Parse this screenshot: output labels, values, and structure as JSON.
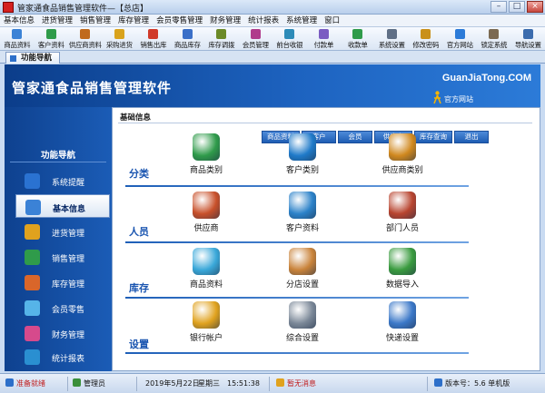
{
  "window": {
    "title": "管家通食品销售管理软件—【总店】",
    "app_icon": "app-logo-icon",
    "buttons": [
      "–",
      "□",
      "×"
    ]
  },
  "menu": [
    "基本信息",
    "进货管理",
    "销售管理",
    "库存管理",
    "会员零售管理",
    "财务管理",
    "统计报表",
    "系统管理",
    "窗口"
  ],
  "toolbar": [
    {
      "label": "商品资料",
      "icon": "goods-icon",
      "color": "#3b82d6"
    },
    {
      "label": "客户资料",
      "icon": "customer-icon",
      "color": "#2f9b4a"
    },
    {
      "label": "供应商资料",
      "icon": "supplier-icon",
      "color": "#c06a1d"
    },
    {
      "label": "采购进货",
      "icon": "purchase-icon",
      "color": "#d9a31c"
    },
    {
      "label": "销售出库",
      "icon": "sales-icon",
      "color": "#d03a2a"
    },
    {
      "label": "商品库存",
      "icon": "stock-icon",
      "color": "#3a6fc8"
    },
    {
      "label": "库存调拨",
      "icon": "transfer-icon",
      "color": "#6b8a28"
    },
    {
      "label": "会员管理",
      "icon": "member-icon",
      "color": "#b03c8c"
    },
    {
      "label": "前台收银",
      "icon": "cashier-icon",
      "color": "#2d8bb8"
    },
    {
      "label": "付款单",
      "icon": "payment-icon",
      "color": "#7a5cc2"
    },
    {
      "label": "收款单",
      "icon": "receipt-icon",
      "color": "#2f9b4a"
    },
    {
      "label": "系统设置",
      "icon": "settings-icon",
      "color": "#5f6f86"
    },
    {
      "label": "修改密码",
      "icon": "password-icon",
      "color": "#c9901a"
    },
    {
      "label": "官方网站",
      "icon": "website-icon",
      "color": "#2c7bd8"
    },
    {
      "label": "锁定系统",
      "icon": "lock-icon",
      "color": "#7b6a52"
    },
    {
      "label": "导航设置",
      "icon": "nav-settings-icon",
      "color": "#3b6cae"
    }
  ],
  "tab": {
    "label": "功能导航",
    "icon": "navigation-icon"
  },
  "banner": {
    "name": "管家通食品销售管理软件",
    "url": "GuanJiaTong.COM",
    "site_link": "官方网站",
    "person_icon": "mascot-icon"
  },
  "sidebar": {
    "heading": "功能导航",
    "items": [
      {
        "label": "系统提醒",
        "icon": "info-icon",
        "color": "#2a72d1"
      },
      {
        "label": "基本信息",
        "icon": "basic-info-icon",
        "color": "#3b82d6"
      },
      {
        "label": "进货管理",
        "icon": "purchase-icon",
        "color": "#e0a21e"
      },
      {
        "label": "销售管理",
        "icon": "sales-icon",
        "color": "#2f9b4a"
      },
      {
        "label": "库存管理",
        "icon": "warehouse-icon",
        "color": "#d9662a"
      },
      {
        "label": "会员零售",
        "icon": "member-icon",
        "color": "#56b4e8"
      },
      {
        "label": "财务管理",
        "icon": "finance-icon",
        "color": "#d64a8c"
      },
      {
        "label": "统计报表",
        "icon": "report-icon",
        "color": "#2a8fd1"
      }
    ]
  },
  "main": {
    "breadcrumb": "基础信息",
    "subtabs": [
      "商品资料",
      "客户",
      "会员",
      "供应商",
      "库存查询",
      "退出"
    ],
    "sections": [
      {
        "title": "分类",
        "items": [
          {
            "label": "商品类别",
            "icon": "goods-category-icon",
            "color": "#2f9b4a"
          },
          {
            "label": "客户类别",
            "icon": "customer-category-icon",
            "color": "#1f7ac9"
          },
          {
            "label": "供应商类别",
            "icon": "supplier-category-icon",
            "color": "#d0881e"
          }
        ]
      },
      {
        "title": "人员",
        "items": [
          {
            "label": "供应商",
            "icon": "supplier-person-icon",
            "color": "#c8502a"
          },
          {
            "label": "客户资料",
            "icon": "customer-person-icon",
            "color": "#2c82c9"
          },
          {
            "label": "部门人员",
            "icon": "department-person-icon",
            "color": "#b8442f"
          }
        ]
      },
      {
        "title": "库存",
        "items": [
          {
            "label": "商品资料",
            "icon": "goods-boxes-icon",
            "color": "#3aa8d9"
          },
          {
            "label": "分店设置",
            "icon": "branch-house-icon",
            "color": "#c9833a"
          },
          {
            "label": "数据导入",
            "icon": "import-icon",
            "color": "#3a9b3f"
          }
        ]
      },
      {
        "title": "设置",
        "items": [
          {
            "label": "银行帐户",
            "icon": "bank-account-icon",
            "color": "#e0a21e"
          },
          {
            "label": "综合设置",
            "icon": "general-settings-icon",
            "color": "#7a8797"
          },
          {
            "label": "快递设置",
            "icon": "express-icon",
            "color": "#3b78c8"
          }
        ]
      }
    ]
  },
  "status": {
    "user_tag": "准备就绪",
    "user": "管理员",
    "date": "2019年5月22日",
    "weekday": "星期三",
    "time": "15:51:38",
    "message": "暂无消息",
    "version": "版本号：5.6 单机版"
  }
}
